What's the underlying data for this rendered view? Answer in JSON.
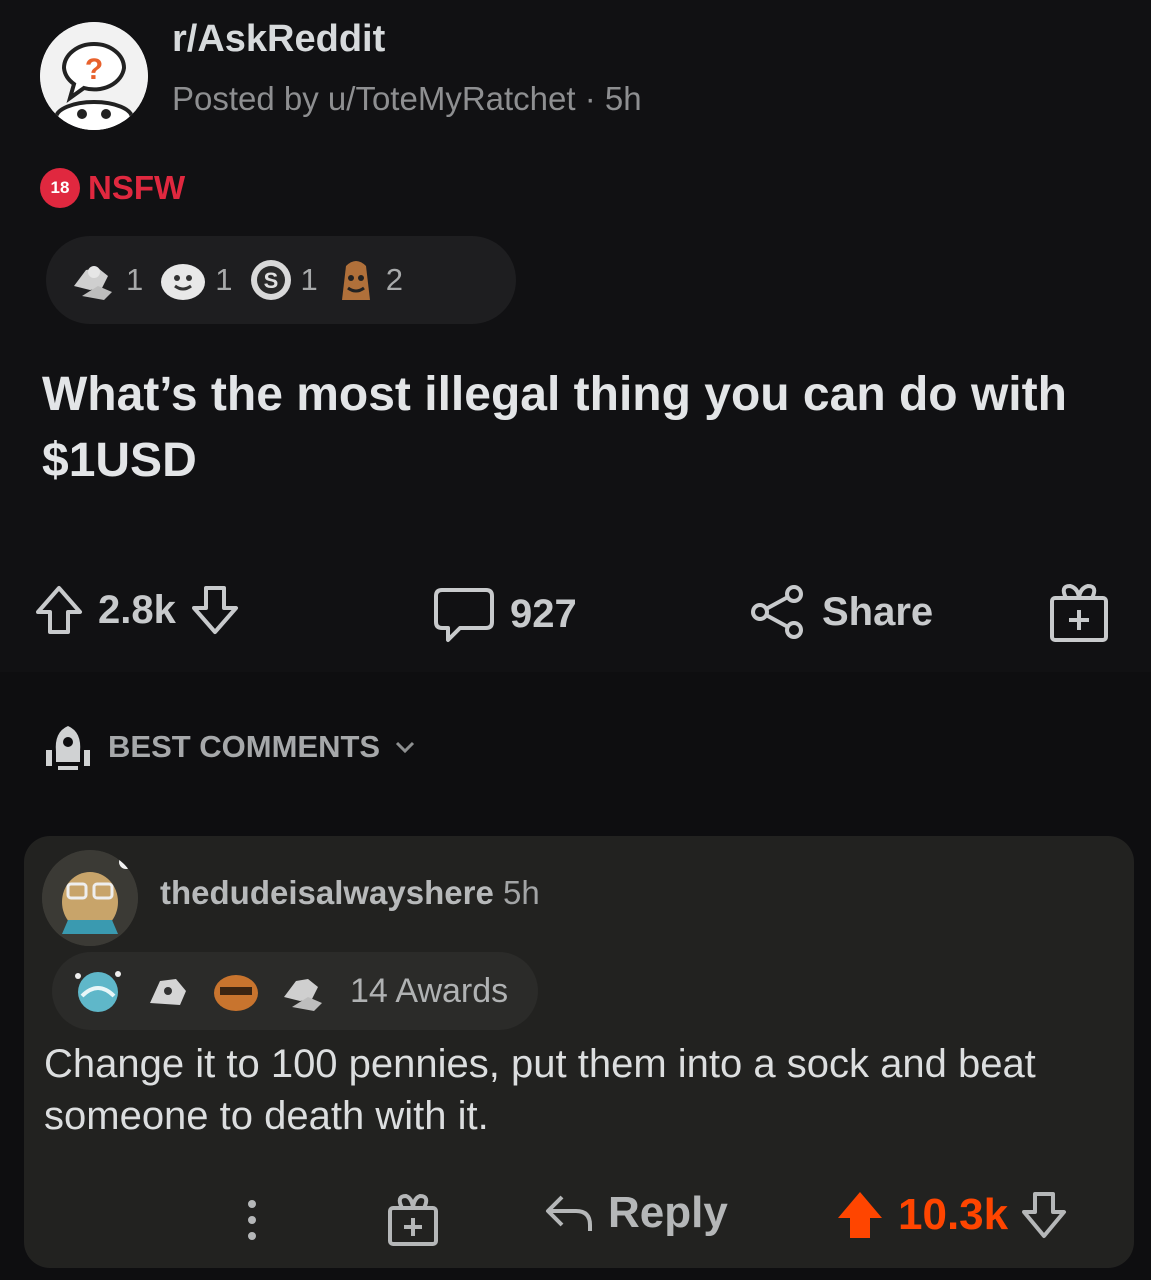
{
  "post": {
    "subreddit": "r/AskReddit",
    "posted_by": "Posted by u/ToteMyRatchet · 5h",
    "nsfw_badge": "18",
    "nsfw_label": "NSFW",
    "awards": [
      {
        "icon": "hands-award-icon",
        "count": "1"
      },
      {
        "icon": "wholesome-award-icon",
        "count": "1"
      },
      {
        "icon": "silver-award-icon",
        "count": "1"
      },
      {
        "icon": "helpful-award-icon",
        "count": "2"
      }
    ],
    "title": "What’s the most illegal thing you can do with $1USD",
    "votes": "2.8k",
    "comments": "927",
    "share_label": "Share"
  },
  "sort": {
    "label": "BEST COMMENTS"
  },
  "comment": {
    "username": "thedudeisalwayshere",
    "time": "5h",
    "awards_label": "14 Awards",
    "body": "Change it to 100 pennies, put them into a sock and beat someone to death with it.",
    "reply_label": "Reply",
    "votes": "10.3k"
  },
  "colors": {
    "accent": "#ff4500",
    "nsfw": "#e0283f",
    "background": "#111113",
    "comment_bg": "#222220"
  }
}
